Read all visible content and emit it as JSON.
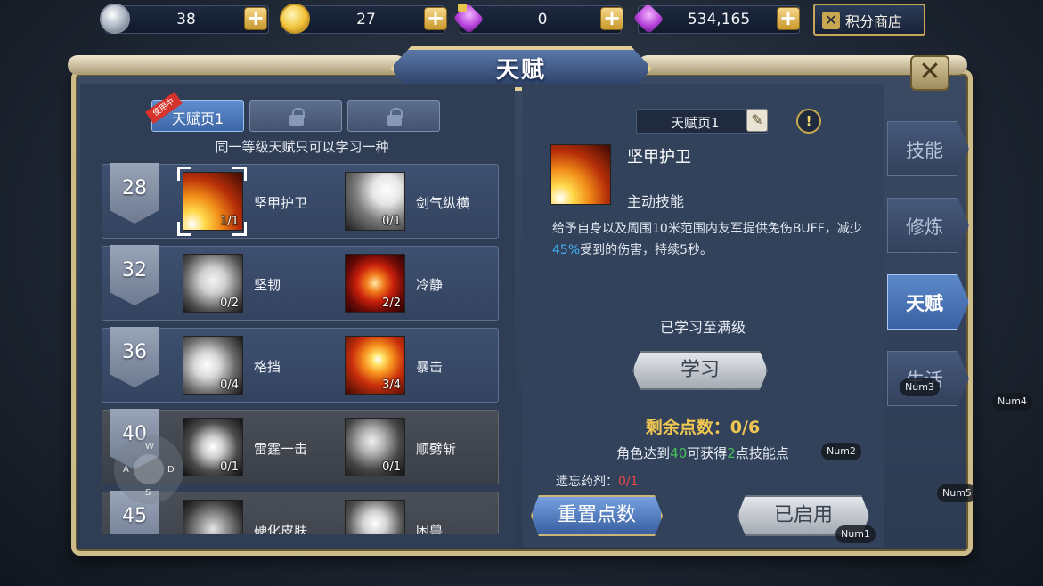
{
  "currencies": [
    {
      "icon": "silver-coin-icon",
      "value": "38"
    },
    {
      "icon": "gold-coin-icon",
      "value": "27"
    },
    {
      "icon": "locked-gem-icon",
      "value": "0"
    },
    {
      "icon": "purple-gem-icon",
      "value": "534,165"
    }
  ],
  "shop": {
    "label": "积分商店"
  },
  "title": "天赋",
  "close_glyph": "✕",
  "talent_pages": {
    "tabs": [
      {
        "label": "天赋页1",
        "active": true,
        "locked": false
      },
      {
        "label": "",
        "active": false,
        "locked": true
      },
      {
        "label": "",
        "active": false,
        "locked": true
      }
    ],
    "in_use_ribbon": "使用中",
    "hint": "同一等级天赋只可以学习一种"
  },
  "talent_rows": [
    {
      "level": "28",
      "locked": false,
      "skills": [
        {
          "name": "坚甲护卫",
          "count": "1/1",
          "icon": "sunburst-icon",
          "selected": true
        },
        {
          "name": "剑气纵横",
          "count": "0/1",
          "icon": "sword-slash-icon",
          "selected": false
        }
      ]
    },
    {
      "level": "32",
      "locked": false,
      "skills": [
        {
          "name": "坚韧",
          "count": "0/2",
          "icon": "shield-icon",
          "selected": false
        },
        {
          "name": "冷静",
          "count": "2/2",
          "icon": "calm-aura-icon",
          "selected": false
        }
      ]
    },
    {
      "level": "36",
      "locked": false,
      "skills": [
        {
          "name": "格挡",
          "count": "0/4",
          "icon": "block-icon",
          "selected": false
        },
        {
          "name": "暴击",
          "count": "3/4",
          "icon": "critical-burst-icon",
          "selected": false
        }
      ]
    },
    {
      "level": "40",
      "locked": true,
      "skills": [
        {
          "name": "雷霆一击",
          "count": "0/1",
          "icon": "thunder-icon",
          "selected": false
        },
        {
          "name": "顺劈斩",
          "count": "0/1",
          "icon": "cleave-icon",
          "selected": false
        }
      ]
    },
    {
      "level": "45",
      "locked": true,
      "skills": [
        {
          "name": "硬化皮肤",
          "count": "",
          "icon": "hardened-skin-icon",
          "selected": false
        },
        {
          "name": "困兽",
          "count": "",
          "icon": "trapped-beast-icon",
          "selected": false
        }
      ]
    }
  ],
  "detail": {
    "page_name": "天赋页1",
    "edit_glyph": "✎",
    "info_glyph": "!",
    "skill_name": "坚甲护卫",
    "skill_type": "主动技能",
    "desc_part1": "给予自身以及周围10米范围内友军提供免伤BUFF，减少",
    "desc_highlight": "45%",
    "desc_part2": "受到的伤害，持续5秒。",
    "maxed_text": "已学习至满级",
    "learn_label": "学习",
    "points_label": "剩余点数：0/6",
    "points_hint_a": "角色达到",
    "points_hint_level": "40",
    "points_hint_b": "可获得",
    "points_hint_num": "2",
    "points_hint_c": "点技能点",
    "potion_label": "遗忘药剂：",
    "potion_value": "0/1",
    "reset_label": "重置点数",
    "enabled_label": "已启用"
  },
  "side_tabs": [
    {
      "label": "技能",
      "active": false
    },
    {
      "label": "修炼",
      "active": false
    },
    {
      "label": "天赋",
      "active": true
    },
    {
      "label": "生活",
      "active": false
    }
  ],
  "overlay": {
    "num_keys": [
      "Num1",
      "Num2",
      "Num3",
      "Num4",
      "Num5"
    ],
    "joystick_keys": [
      "W",
      "A",
      "S",
      "D"
    ]
  },
  "colors": {
    "accent_gold": "#cdbb8a",
    "highlight_blue": "#42b4f6",
    "points_gold": "#f0c652",
    "green": "#46c25a",
    "red": "#e84848"
  }
}
